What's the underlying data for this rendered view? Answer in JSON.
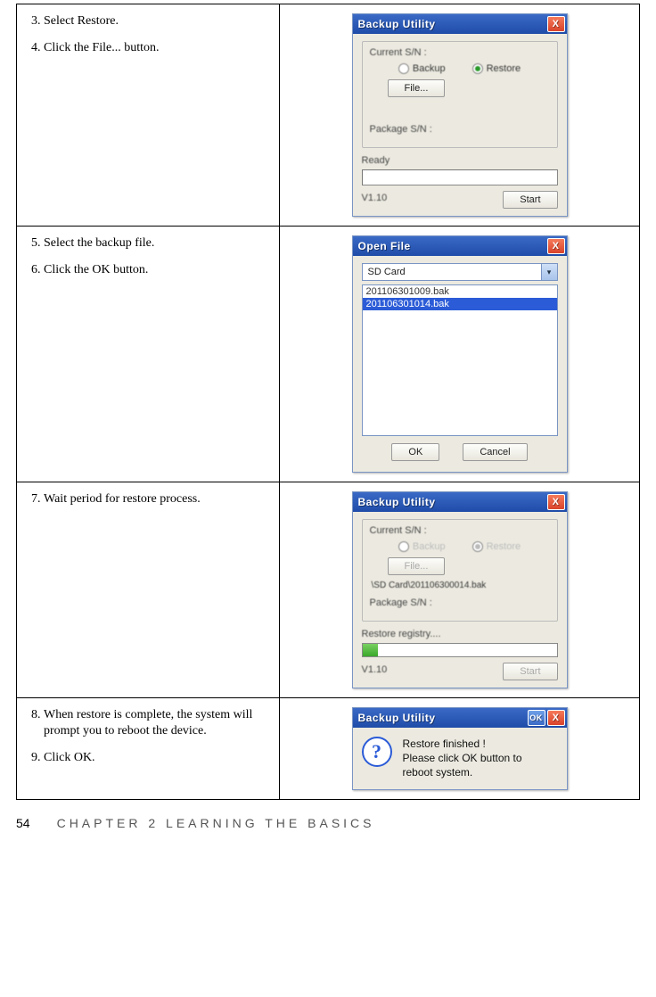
{
  "row1": {
    "steps": [
      {
        "n": "3",
        "text": "Select Restore."
      },
      {
        "n": "4",
        "text": "Click the File... button."
      }
    ],
    "dlg": {
      "title": "Backup Utility",
      "current_sn": "Current S/N :",
      "radio_backup": "Backup",
      "radio_restore": "Restore",
      "file_btn": "File...",
      "package_sn": "Package S/N :",
      "status": "Ready",
      "version": "V1.10",
      "start_btn": "Start"
    }
  },
  "row2": {
    "steps": [
      {
        "n": "5",
        "text": "Select the backup file."
      },
      {
        "n": "6",
        "text": "Click the OK button."
      }
    ],
    "dlg": {
      "title": "Open File",
      "drive": "SD Card",
      "items": [
        "201106301009.bak",
        "201106301014.bak"
      ],
      "ok": "OK",
      "cancel": "Cancel"
    }
  },
  "row3": {
    "steps": [
      {
        "n": "7",
        "text": "Wait period for restore process."
      }
    ],
    "dlg": {
      "title": "Backup Utility",
      "current_sn": "Current S/N :",
      "radio_backup": "Backup",
      "radio_restore": "Restore",
      "file_btn": "File...",
      "path": "\\SD Card\\201106300014.bak",
      "package_sn": "Package S/N :",
      "status": "Restore registry....",
      "version": "V1.10",
      "start_btn": "Start",
      "progress_pct": 8
    }
  },
  "row4": {
    "steps": [
      {
        "n": "8",
        "text": "When restore is complete, the system will prompt you to reboot the device."
      },
      {
        "n": "9",
        "text": "Click OK."
      }
    ],
    "dlg": {
      "title": "Backup Utility",
      "ok": "OK",
      "msg_l1": "Restore finished !",
      "msg_l2": "Please click OK button to",
      "msg_l3": "reboot system."
    }
  },
  "footer": {
    "page": "54",
    "chapter": "CHAPTER 2 LEARNING THE BASICS"
  }
}
